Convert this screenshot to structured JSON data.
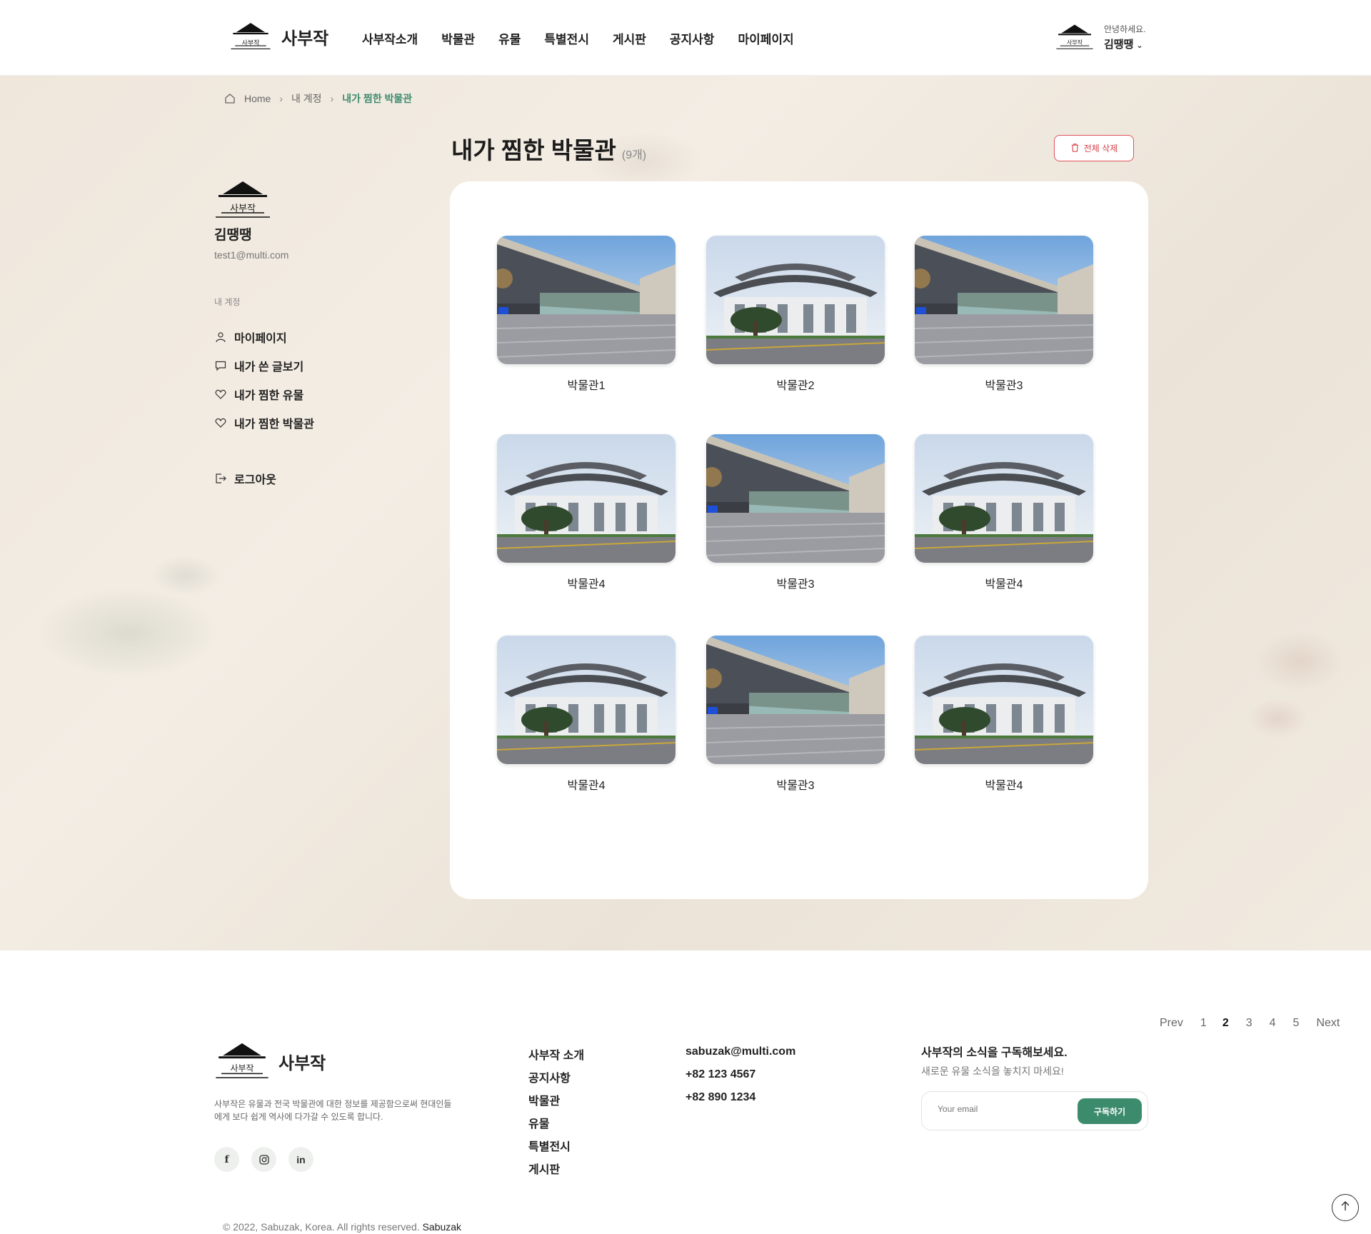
{
  "header": {
    "brand": "사부작",
    "logo_text": "사부작",
    "nav": [
      "사부작소개",
      "박물관",
      "유물",
      "특별전시",
      "게시판",
      "공지사항",
      "마이페이지"
    ],
    "greeting": "안녕하세요.",
    "username": "김땡땡"
  },
  "breadcrumb": {
    "home": "Home",
    "level1": "내 계정",
    "current": "내가 찜한 박물관"
  },
  "sidebar": {
    "name": "김땡땡",
    "email": "test1@multi.com",
    "section": "내 계정",
    "items": [
      {
        "label": "마이페이지",
        "icon": "user-icon"
      },
      {
        "label": "내가 쓴 글보기",
        "icon": "comment-icon"
      },
      {
        "label": "내가 찜한 유물",
        "icon": "heart-icon"
      },
      {
        "label": "내가 찜한 박물관",
        "icon": "heart-icon"
      }
    ],
    "logout": "로그아웃"
  },
  "main": {
    "title": "내가 찜한 박물관",
    "count": "(9개)",
    "delete_all": "전체 삭제",
    "museums": [
      {
        "label": "박물관1",
        "image": "modern-museum"
      },
      {
        "label": "박물관2",
        "image": "traditional-museum"
      },
      {
        "label": "박물관3",
        "image": "modern-museum"
      },
      {
        "label": "박물관4",
        "image": "traditional-museum"
      },
      {
        "label": "박물관3",
        "image": "modern-museum"
      },
      {
        "label": "박물관4",
        "image": "traditional-museum"
      },
      {
        "label": "박물관4",
        "image": "traditional-museum"
      },
      {
        "label": "박물관3",
        "image": "modern-museum"
      },
      {
        "label": "박물관4",
        "image": "traditional-museum"
      }
    ],
    "pagination": {
      "prev": "Prev",
      "pages": [
        "1",
        "2",
        "3",
        "4",
        "5"
      ],
      "active": "2",
      "next": "Next"
    }
  },
  "footer": {
    "brand": "사부작",
    "description": "사부작은 유물과 전국 박물관에 대한 정보를 제공함으로써 현대인들에게 보다 쉽게 역사에 다가갈 수 있도록 합니다.",
    "socials": [
      "f",
      "ig",
      "in"
    ],
    "menu": [
      "사부작 소개",
      "공지사항",
      "박물관",
      "유물",
      "특별전시",
      "게시판"
    ],
    "contact": {
      "email": "sabuzak@multi.com",
      "phone1": "+82 123 4567",
      "phone2": "+82 890 1234"
    },
    "subscribe_title": "사부작의 소식을 구독해보세요.",
    "subscribe_sub": "새로운 유물 소식을 놓치지 마세요!",
    "email_placeholder": "Your email",
    "subscribe_button": "구독하기",
    "copyright": "© 2022, Sabuzak, Korea. All rights reserved.",
    "copyright_brand": "Sabuzak"
  },
  "colors": {
    "accent": "#3d8b6d",
    "danger": "#d6444c"
  }
}
